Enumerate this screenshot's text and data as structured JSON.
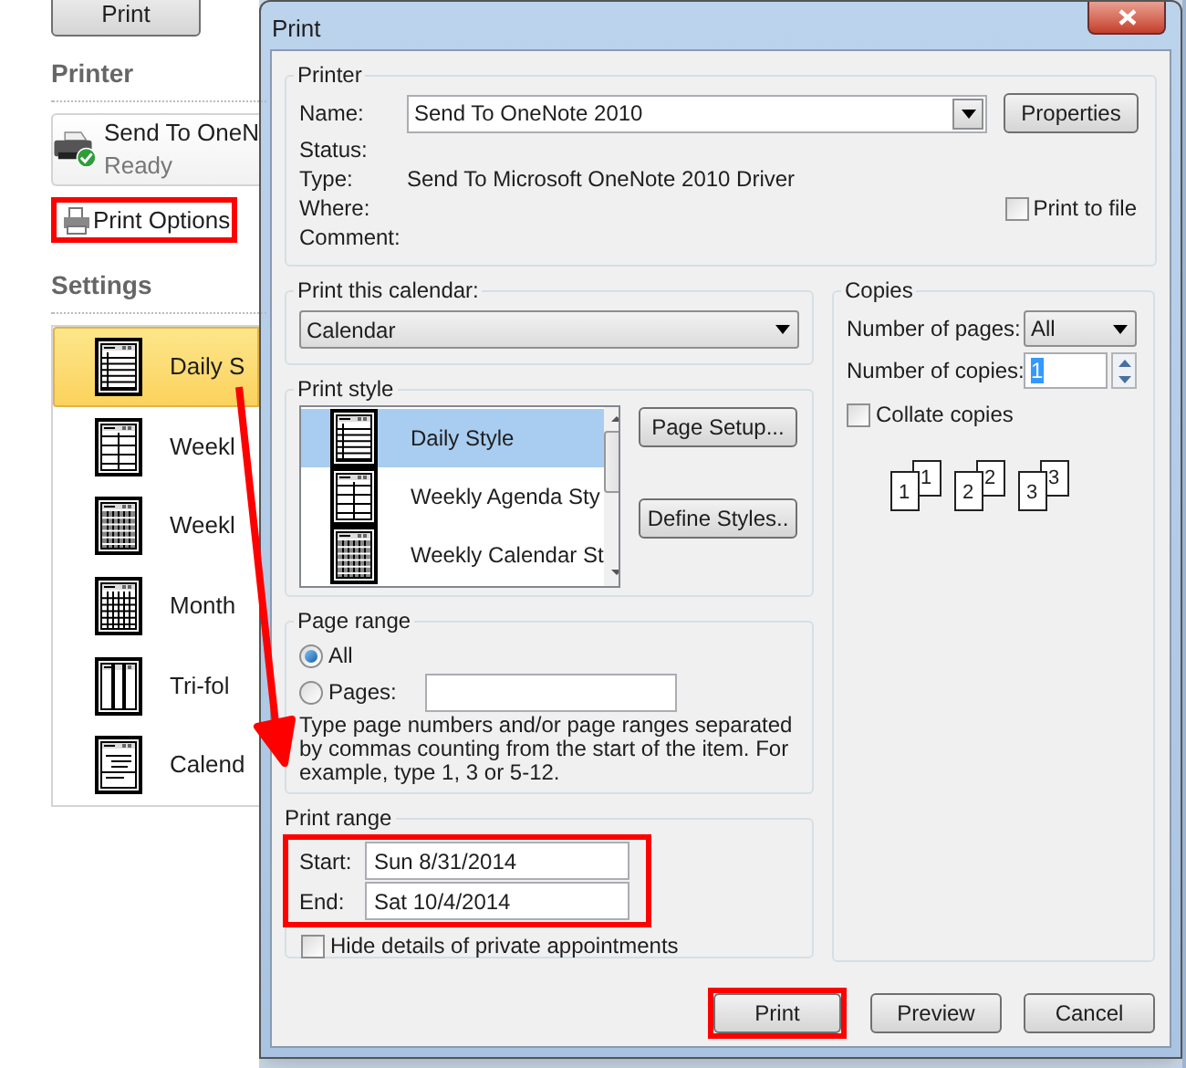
{
  "backstage": {
    "print_button": "Print",
    "printer_heading": "Printer",
    "printer": {
      "name": "Send To OneN",
      "status": "Ready"
    },
    "print_options": "Print Options",
    "settings_heading": "Settings",
    "styles": [
      {
        "label": "Daily S",
        "kind": "daily",
        "selected": true
      },
      {
        "label": "Weekl",
        "kind": "agenda",
        "selected": false
      },
      {
        "label": "Weekl",
        "kind": "week",
        "selected": false
      },
      {
        "label": "Month",
        "kind": "month",
        "selected": false
      },
      {
        "label": "Tri-fol",
        "kind": "trifold",
        "selected": false
      },
      {
        "label": "Calend",
        "kind": "details",
        "selected": false
      }
    ]
  },
  "dialog": {
    "title": "Print",
    "printer": {
      "group": "Printer",
      "name_label": "Name:",
      "name_value": "Send To OneNote 2010",
      "properties_button": "Properties",
      "fields": [
        {
          "label": "Status:"
        },
        {
          "label": "Type:",
          "value": "Send To Microsoft OneNote 2010 Driver"
        },
        {
          "label": "Where:"
        },
        {
          "label": "Comment:"
        }
      ],
      "print_to_file": {
        "label": "Print to file",
        "checked": false
      }
    },
    "calendar": {
      "group": "Print this calendar:",
      "value": "Calendar"
    },
    "print_style": {
      "group": "Print style",
      "items": [
        {
          "label": "Daily Style",
          "kind": "daily",
          "selected": true
        },
        {
          "label": "Weekly Agenda Sty",
          "kind": "agenda",
          "selected": false
        },
        {
          "label": "Weekly Calendar St",
          "kind": "week",
          "selected": false
        }
      ],
      "buttons": [
        "Page Setup...",
        "Define Styles.."
      ]
    },
    "page_range": {
      "group": "Page range",
      "options": [
        {
          "label": "All",
          "selected": true
        },
        {
          "label": "Pages:",
          "selected": false
        }
      ],
      "hint": "Type page numbers and/or page ranges separated by commas counting from the start of the item.  For example, type 1, 3 or 5-12."
    },
    "print_range": {
      "group": "Print range",
      "start_label": "Start:",
      "start": "Sun 8/31/2014",
      "end_label": "End:",
      "end": "Sat 10/4/2014",
      "hide_private": {
        "label": "Hide details of private appointments",
        "checked": false
      }
    },
    "copies": {
      "group": "Copies",
      "pages_label": "Number of pages:",
      "pages_value": "All",
      "copies_label": "Number of copies:",
      "copies_value": "1",
      "collate": {
        "label": "Collate copies",
        "checked": false
      },
      "sets": [
        {
          "back": "1",
          "front": "1"
        },
        {
          "back": "2",
          "front": "2"
        },
        {
          "back": "3",
          "front": "3"
        }
      ]
    },
    "buttons": [
      "Print",
      "Preview",
      "Cancel"
    ]
  }
}
